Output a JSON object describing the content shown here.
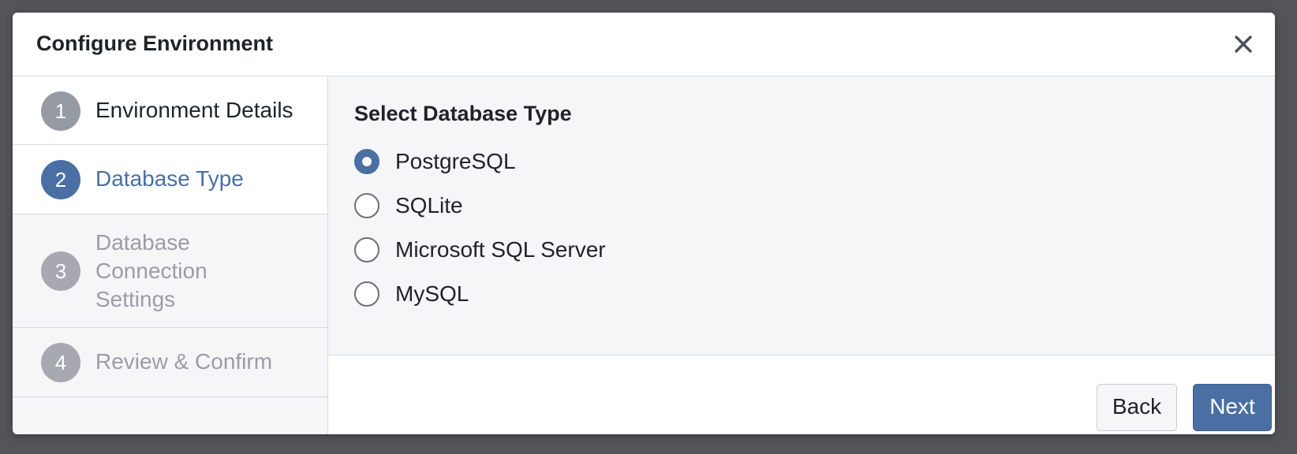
{
  "modal": {
    "title": "Configure Environment",
    "close_icon": "close-icon"
  },
  "steps": [
    {
      "number": "1",
      "label": "Environment Details",
      "state": "complete"
    },
    {
      "number": "2",
      "label": "Database Type",
      "state": "active"
    },
    {
      "number": "3",
      "label_lines": [
        "Database",
        "Connection",
        "Settings"
      ],
      "state": "disabled"
    },
    {
      "number": "4",
      "label": "Review & Confirm",
      "state": "disabled"
    }
  ],
  "content": {
    "section_title": "Select Database Type",
    "options": [
      {
        "label": "PostgreSQL",
        "checked": true
      },
      {
        "label": "SQLite",
        "checked": false
      },
      {
        "label": "Microsoft SQL Server",
        "checked": false
      },
      {
        "label": "MySQL",
        "checked": false
      }
    ]
  },
  "footer": {
    "back_label": "Back",
    "next_label": "Next"
  },
  "colors": {
    "accent": "#4a6fa2",
    "backdrop": "#54555a",
    "panel": "#f5f6f8",
    "muted": "#9a9da4"
  }
}
